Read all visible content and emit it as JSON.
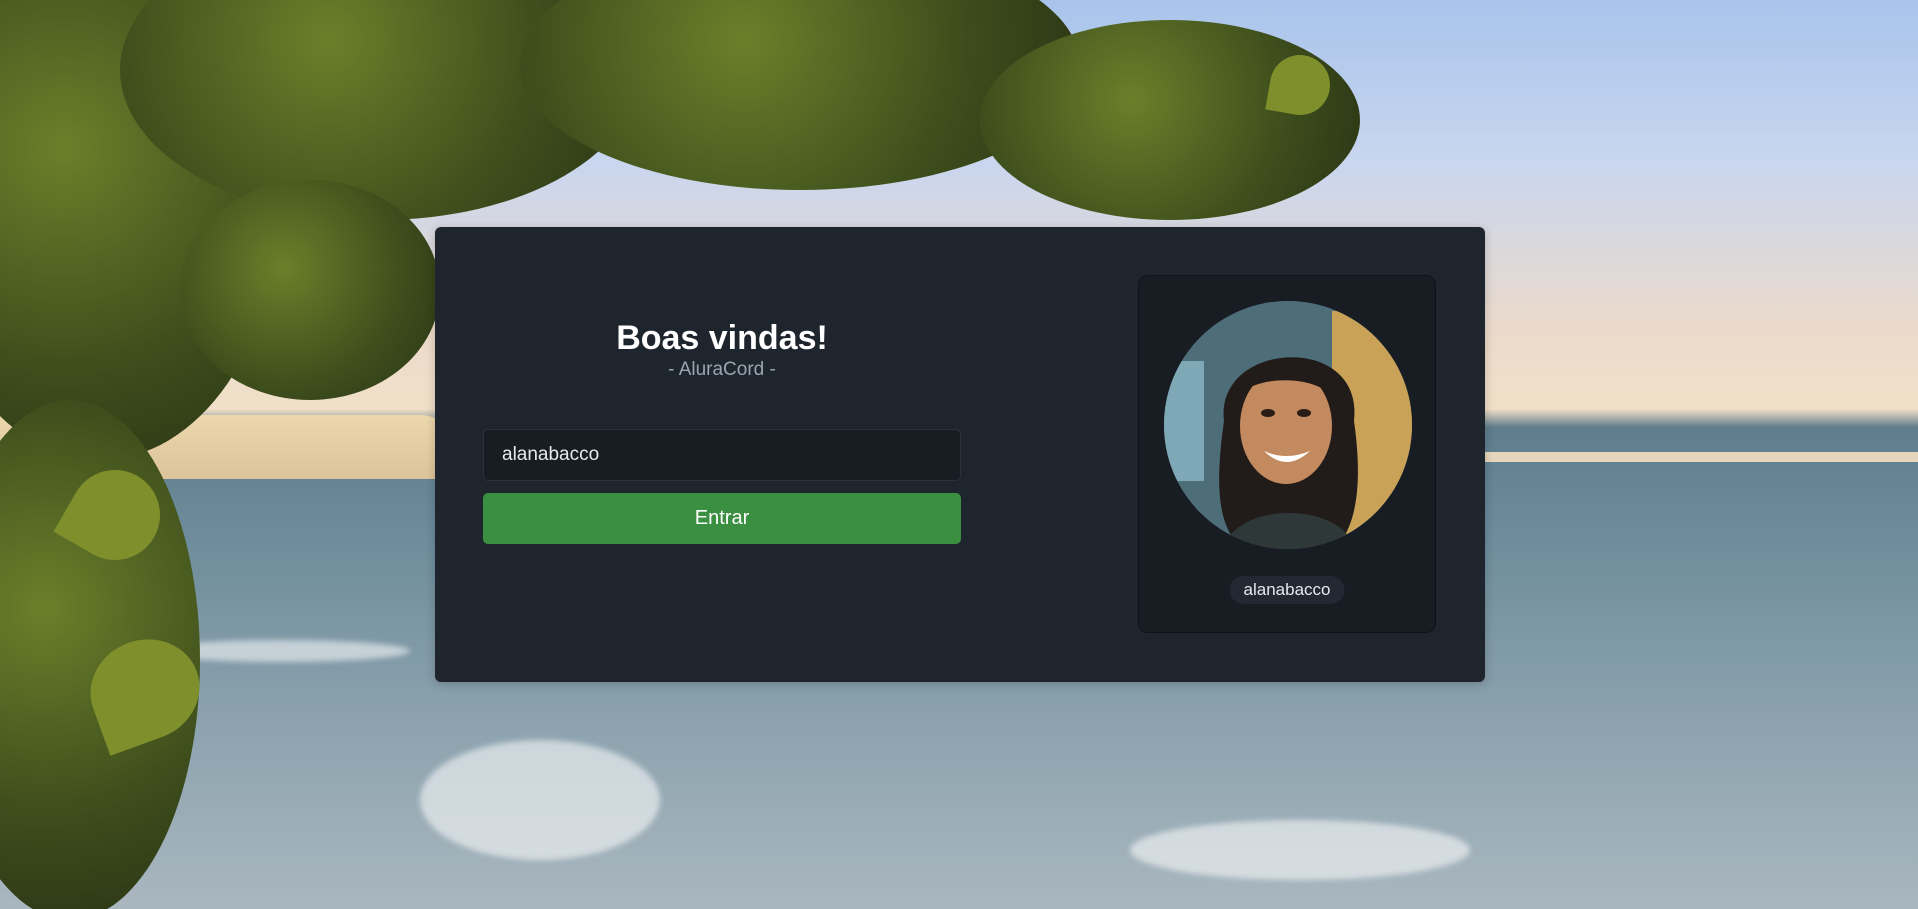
{
  "login": {
    "title": "Boas vindas!",
    "subtitle": "- AluraCord -",
    "username_value": "alanabacco",
    "enter_label": "Entrar"
  },
  "profile": {
    "avatar_icon": "user-photo",
    "username": "alanabacco"
  },
  "colors": {
    "card_bg": "#1f252d",
    "panel_bg": "#181d24",
    "button_bg": "#3a8f41",
    "title": "#ffffff",
    "subtitle": "#9aa5b1"
  }
}
